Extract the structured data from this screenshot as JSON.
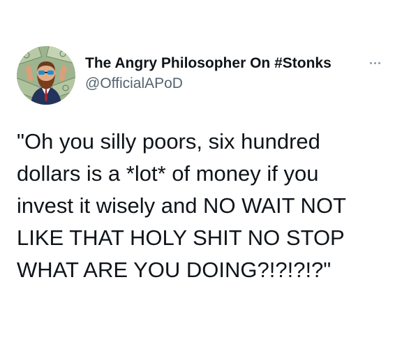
{
  "tweet": {
    "author": {
      "display_name": "The Angry Philosopher On #Stonks",
      "handle": "@OfficialAPoD",
      "avatar": "avatar-cartoon-man-with-sunglasses-and-money-background"
    },
    "more_icon": "more-horizontal-icon",
    "text_lines": [
      "\"Oh you silly poors, six hundred",
      "dollars is a *lot* of money if you",
      "invest it wisely and NO WAIT NOT",
      "LIKE THAT HOLY SHIT NO STOP",
      "WHAT ARE YOU DOING?!?!?!?\""
    ]
  },
  "colors": {
    "text": "#0f1419",
    "secondary_text": "#536471",
    "background": "#ffffff"
  }
}
